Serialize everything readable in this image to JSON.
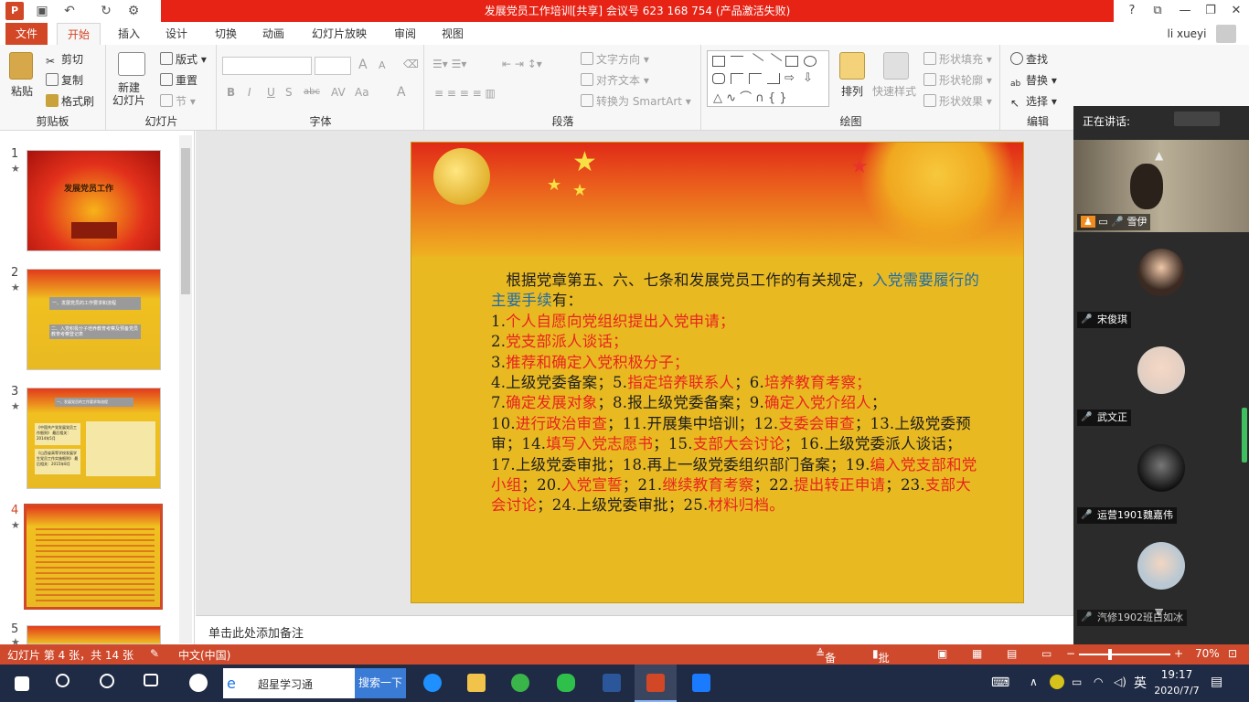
{
  "window": {
    "title": "发展党员工作培训[共享] 会议号 623 168 754 (产品激活失败)",
    "help": "?",
    "user": "li xueyi"
  },
  "ribbon_tabs": [
    "文件",
    "开始",
    "插入",
    "设计",
    "切换",
    "动画",
    "幻灯片放映",
    "审阅",
    "视图"
  ],
  "ribbon": {
    "clipboard": {
      "paste": "粘贴",
      "cut": "剪切",
      "copy": "复制",
      "format_painter": "格式刷",
      "label": "剪贴板"
    },
    "slides": {
      "new_slide": "新建\n幻灯片",
      "layout": "版式",
      "reset": "重置",
      "section": "节",
      "label": "幻灯片"
    },
    "font": {
      "label": "字体",
      "bold": "B",
      "italic": "I",
      "underline": "U",
      "strike": "abc",
      "grow": "A",
      "shrink": "A",
      "aa": "Aa",
      "fontcolor": "A"
    },
    "paragraph": {
      "text_direction": "文字方向",
      "align_text": "对齐文本",
      "smartart": "转换为 SmartArt",
      "label": "段落"
    },
    "drawing": {
      "arrange": "排列",
      "quick_styles": "快速样式",
      "fill": "形状填充",
      "outline": "形状轮廓",
      "effects": "形状效果",
      "label": "绘图"
    },
    "editing": {
      "find": "查找",
      "replace": "替换",
      "select": "选择",
      "label": "编辑"
    }
  },
  "thumbnails": [
    {
      "num": "1",
      "star": "★",
      "title": "发展党员工作"
    },
    {
      "num": "2",
      "star": "★",
      "line1": "一、发展党员的工作要求和流程",
      "line2": "二、入党积极分子培养教育考察及预备党员教育考察登记表"
    },
    {
      "num": "3",
      "star": "★",
      "title": "一、发展党员的工作要求和流程",
      "left1": "《中国共产党发展党员工作细则》",
      "left1b": "最后相关：2014年5月",
      "left2": "《山西省高等学校发展学生党员工作实施细则》",
      "left2b": "最后相关：2015年8月"
    },
    {
      "num": "4",
      "star": "★"
    },
    {
      "num": "5",
      "star": "★"
    }
  ],
  "slide": {
    "intro": "根据党章第五、六、七条和发展党员工作的有关规定，",
    "intro_blue": "入党需要履行的主要手续",
    "intro_end": "有：",
    "items": [
      {
        "n": "1.",
        "t": "个人自愿向党组织提出入党申请；",
        "red": true
      },
      {
        "n": "2.",
        "t": "党支部派人谈话；",
        "red": true
      },
      {
        "n": "3.",
        "t": "推荐和确定入党积极分子；",
        "red": true
      }
    ],
    "line4": [
      {
        "t": "4.上级党委备案；",
        "red": false
      },
      {
        "t": "5.",
        "red": false
      },
      {
        "t": "指定培养联系人",
        "red": true
      },
      {
        "t": "；6.",
        "red": false
      },
      {
        "t": "培养教育考察；",
        "red": true
      }
    ],
    "line7": [
      {
        "t": "7.",
        "red": false
      },
      {
        "t": "确定发展对象",
        "red": true
      },
      {
        "t": "；8.报上级党委备案；9.",
        "red": false
      },
      {
        "t": "确定入党介绍人",
        "red": true
      },
      {
        "t": "；",
        "red": false
      }
    ],
    "rest": [
      {
        "t": "10.",
        "red": false
      },
      {
        "t": "进行政治审查",
        "red": true
      },
      {
        "t": "；11.开展集中培训；12.",
        "red": false
      },
      {
        "t": "支委会审查",
        "red": true
      },
      {
        "t": "；13.上级党委预审；14.",
        "red": false
      },
      {
        "t": "填写入党志愿书",
        "red": true
      },
      {
        "t": "；15.",
        "red": false
      },
      {
        "t": "支部大会讨论",
        "red": true
      },
      {
        "t": "；16.上级党委派人谈话；17.上级党委审批；18.再上一级党委组织部门备案；19.",
        "red": false
      },
      {
        "t": "编入党支部和党小组",
        "red": true
      },
      {
        "t": "；20.",
        "red": false
      },
      {
        "t": "入党宣誓",
        "red": true
      },
      {
        "t": "；21.",
        "red": false
      },
      {
        "t": "继续教育考察",
        "red": true
      },
      {
        "t": "；22.",
        "red": false
      },
      {
        "t": "提出转正申请",
        "red": true
      },
      {
        "t": "；23.",
        "red": false
      },
      {
        "t": "支部大会讨论",
        "red": true
      },
      {
        "t": "；24.上级党委审批；25.",
        "red": false
      },
      {
        "t": "材料归档",
        "red": true
      },
      {
        "t": "。",
        "red": true
      }
    ]
  },
  "notes_placeholder": "单击此处添加备注",
  "status": {
    "slide_info": "幻灯片 第 4 张，共 14 张",
    "language": "中文(中国)",
    "notes": "备注",
    "comments": "批注",
    "zoom": "70%"
  },
  "meeting": {
    "speaking_label": "正在讲话:",
    "participants": [
      "雪伊",
      "宋俊琪",
      "武文正",
      "运营1901魏嘉伟",
      "汽修1902班白如冰"
    ]
  },
  "taskbar": {
    "search_placeholder": "超星学习通",
    "search_button": "搜索一下",
    "time": "19:17",
    "date": "2020/7/7"
  },
  "colors": {
    "accent": "#d24726",
    "status_bar": "#cf4a2c",
    "title_red": "#e62315",
    "slide_bg": "#e9b922",
    "red_text": "#e8231f",
    "blue_text": "#1f6ca8"
  }
}
